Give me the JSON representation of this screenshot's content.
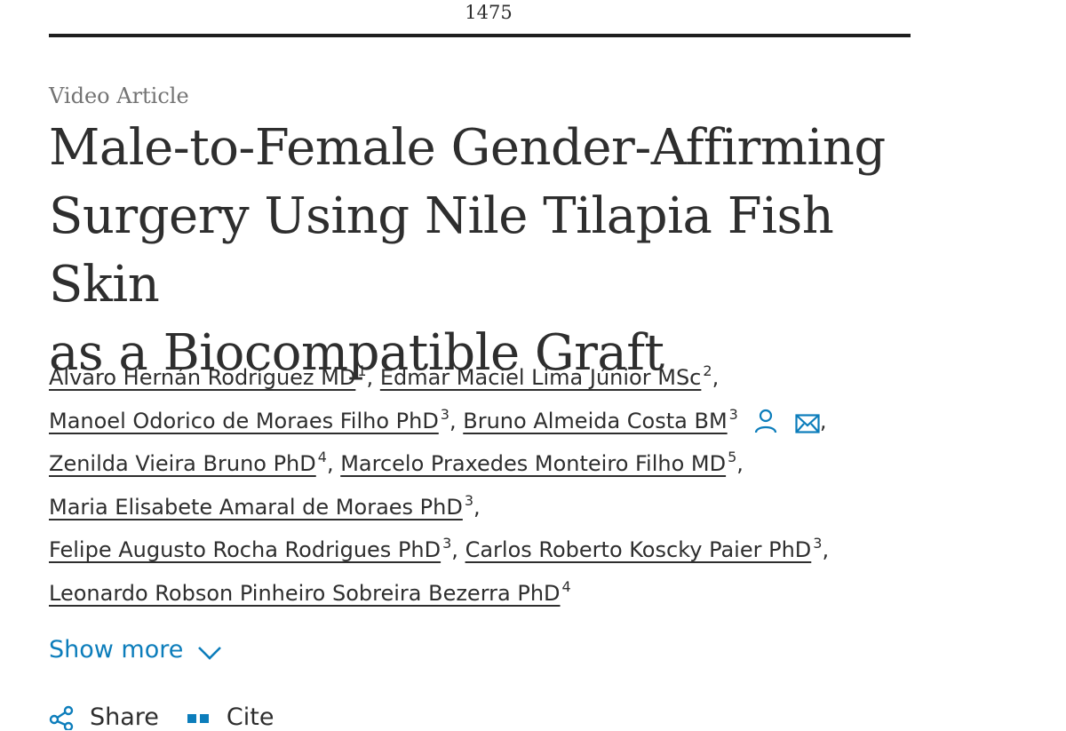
{
  "page_number": "1475",
  "article_type": "Video Article",
  "title_lines": [
    "Male-to-Female Gender-Affirming",
    "Surgery Using Nile Tilapia Fish Skin",
    "as a Biocompatible Graft"
  ],
  "authors": [
    {
      "name": "Álvaro Hernán Rodríguez MD",
      "aff": "1",
      "sep": ","
    },
    {
      "name": "Edmar Maciel Lima Júnior MSc",
      "aff": "2",
      "sep": ","
    },
    {
      "name": "Manoel Odorico de Moraes Filho PhD",
      "aff": "3",
      "sep": ","
    },
    {
      "name": "Bruno Almeida Costa BM",
      "aff": "3",
      "sep": ","
    },
    {
      "name": "Zenilda Vieira Bruno PhD",
      "aff": "4",
      "sep": ","
    },
    {
      "name": "Marcelo Praxedes Monteiro Filho MD",
      "aff": "5",
      "sep": ","
    },
    {
      "name": "Maria Elisabete Amaral de Moraes PhD",
      "aff": "3",
      "sep": ","
    },
    {
      "name": "Felipe Augusto Rocha Rodrigues PhD",
      "aff": "3",
      "sep": ","
    },
    {
      "name": "Carlos Roberto Koscky Paier PhD",
      "aff": "3",
      "sep": ","
    },
    {
      "name": "Leonardo Robson Pinheiro Sobreira Bezerra PhD",
      "aff": "4",
      "sep": ""
    }
  ],
  "corresponding_icons": [
    "person-icon",
    "envelope-icon"
  ],
  "show_more_label": "Show more",
  "toolbar": {
    "share_label": "Share",
    "cite_label": "Cite"
  },
  "colors": {
    "link_blue": "#0c7dbb",
    "text": "#2e2e2e",
    "muted": "#737373"
  }
}
